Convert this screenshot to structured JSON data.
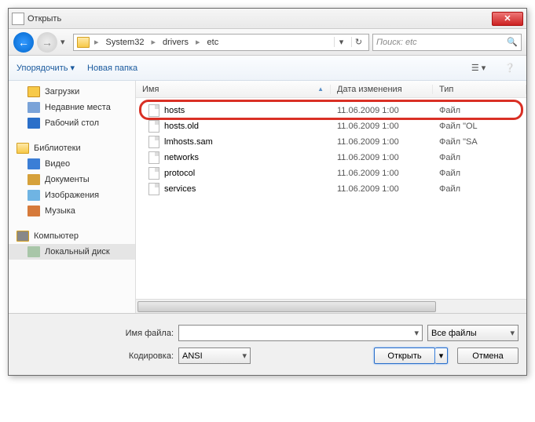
{
  "window": {
    "title": "Открыть"
  },
  "breadcrumb": {
    "items": [
      "System32",
      "drivers",
      "etc"
    ]
  },
  "search": {
    "placeholder": "Поиск: etc"
  },
  "toolbar": {
    "organize": "Упорядочить ▾",
    "newfolder": "Новая папка"
  },
  "sidebar": {
    "quick": [
      {
        "label": "Загрузки",
        "c": "#f7c948"
      },
      {
        "label": "Недавние места",
        "c": "#7aa3d8"
      },
      {
        "label": "Рабочий стол",
        "c": "#2a6fc9"
      }
    ],
    "libheader": "Библиотеки",
    "libs": [
      {
        "label": "Видео",
        "c": "#3b7ed6"
      },
      {
        "label": "Документы",
        "c": "#d6a13b"
      },
      {
        "label": "Изображения",
        "c": "#6fb4e3"
      },
      {
        "label": "Музыка",
        "c": "#d67a3b"
      }
    ],
    "comp": "Компьютер",
    "disk": "Локальный диск"
  },
  "columns": {
    "name": "Имя",
    "date": "Дата изменения",
    "type": "Тип"
  },
  "files": [
    {
      "name": "hosts",
      "date": "11.06.2009 1:00",
      "type": "Файл"
    },
    {
      "name": "hosts.old",
      "date": "11.06.2009 1:00",
      "type": "Файл \"OL"
    },
    {
      "name": "lmhosts.sam",
      "date": "11.06.2009 1:00",
      "type": "Файл \"SA"
    },
    {
      "name": "networks",
      "date": "11.06.2009 1:00",
      "type": "Файл"
    },
    {
      "name": "protocol",
      "date": "11.06.2009 1:00",
      "type": "Файл"
    },
    {
      "name": "services",
      "date": "11.06.2009 1:00",
      "type": "Файл"
    }
  ],
  "bottom": {
    "filename_label": "Имя файла:",
    "encoding_label": "Кодировка:",
    "encoding_value": "ANSI",
    "filter": "Все файлы",
    "open": "Открыть",
    "cancel": "Отмена"
  }
}
